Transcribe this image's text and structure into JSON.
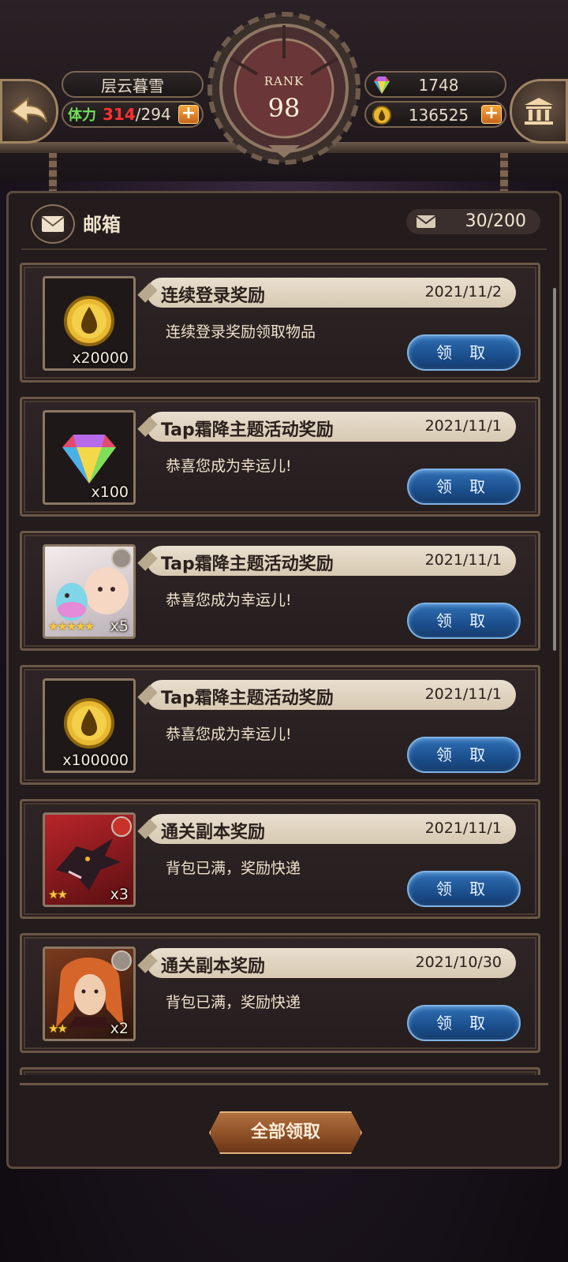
{
  "header": {
    "player_name": "层云暮雪",
    "stamina": {
      "label": "体力",
      "current": "314",
      "separator": "/",
      "max": "294"
    },
    "gems": "1748",
    "gold": "136525",
    "rank": {
      "label": "RANK",
      "value": "98"
    },
    "plus_symbol": "+"
  },
  "mailbox": {
    "title": "邮箱",
    "count": "30/200",
    "claim_all_label": "全部领取",
    "items": [
      {
        "title": "连续登录奖励",
        "date": "2021/11/2",
        "desc": "连续登录奖励领取物品",
        "reward": "gold-coin",
        "qty": "x20000",
        "claim_label": "领 取"
      },
      {
        "title": "Tap霜降主题活动奖励",
        "date": "2021/11/1",
        "desc": "恭喜您成为幸运儿!",
        "reward": "rainbow-gem",
        "qty": "x100",
        "claim_label": "领 取"
      },
      {
        "title": "Tap霜降主题活动奖励",
        "date": "2021/11/1",
        "desc": "恭喜您成为幸运儿!",
        "reward": "slime-character",
        "qty": "x5",
        "stars": "★★★★★",
        "claim_label": "领 取"
      },
      {
        "title": "Tap霜降主题活动奖励",
        "date": "2021/11/1",
        "desc": "恭喜您成为幸运儿!",
        "reward": "gold-coin",
        "qty": "x100000",
        "claim_label": "领 取"
      },
      {
        "title": "通关副本奖励",
        "date": "2021/11/1",
        "desc": "背包已满，奖励快递",
        "reward": "dragon-character",
        "qty": "x3",
        "stars": "★★",
        "claim_label": "领 取"
      },
      {
        "title": "通关副本奖励",
        "date": "2021/10/30",
        "desc": "背包已满，奖励快递",
        "reward": "hero-character",
        "qty": "x2",
        "stars": "★★",
        "claim_label": "领 取"
      }
    ]
  },
  "colors": {
    "claim_button": "#1b4f8d",
    "stamina_current": "#ff3030",
    "stamina_label": "#6fe05a",
    "banner": "#e9dfcf",
    "frame": "#6b5746"
  }
}
